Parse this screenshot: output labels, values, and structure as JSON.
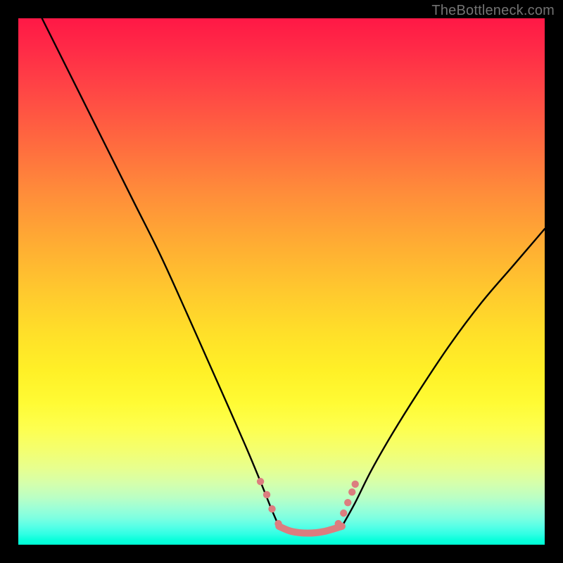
{
  "attribution": "TheBottleneck.com",
  "chart_data": {
    "type": "line",
    "title": "",
    "xlabel": "",
    "ylabel": "",
    "xlim": [
      0,
      100
    ],
    "ylim": [
      0,
      100
    ],
    "grid": false,
    "legend": false,
    "series": [
      {
        "name": "left-curve",
        "stroke": "#000000",
        "x": [
          4.5,
          8,
          12,
          17,
          22,
          27,
          32,
          36,
          40,
          43.5,
          46,
          48,
          49.5
        ],
        "values": [
          100,
          93,
          85,
          75,
          65,
          55,
          44,
          35,
          26,
          18,
          12,
          7,
          3.5
        ]
      },
      {
        "name": "right-curve",
        "stroke": "#000000",
        "x": [
          61.5,
          64,
          67,
          71,
          76,
          82,
          88,
          94,
          100
        ],
        "values": [
          3.5,
          8,
          14,
          21,
          29,
          38,
          46,
          53,
          60
        ]
      },
      {
        "name": "floor-band",
        "stroke": "#dc7d7f",
        "x": [
          49.5,
          52,
          55,
          58,
          61.5
        ],
        "values": [
          3.5,
          2.5,
          2.2,
          2.5,
          3.5
        ]
      }
    ],
    "markers": [
      {
        "series": "left-dots",
        "stroke": "#dc7d7f",
        "points": [
          {
            "x": 46.0,
            "y": 12.0
          },
          {
            "x": 47.2,
            "y": 9.5
          },
          {
            "x": 48.2,
            "y": 6.8
          },
          {
            "x": 49.4,
            "y": 4.0
          }
        ]
      },
      {
        "series": "right-dots",
        "stroke": "#dc7d7f",
        "points": [
          {
            "x": 60.8,
            "y": 4.0
          },
          {
            "x": 61.8,
            "y": 6.0
          },
          {
            "x": 62.6,
            "y": 8.0
          },
          {
            "x": 63.4,
            "y": 10.0
          },
          {
            "x": 64.0,
            "y": 11.5
          }
        ]
      }
    ]
  }
}
